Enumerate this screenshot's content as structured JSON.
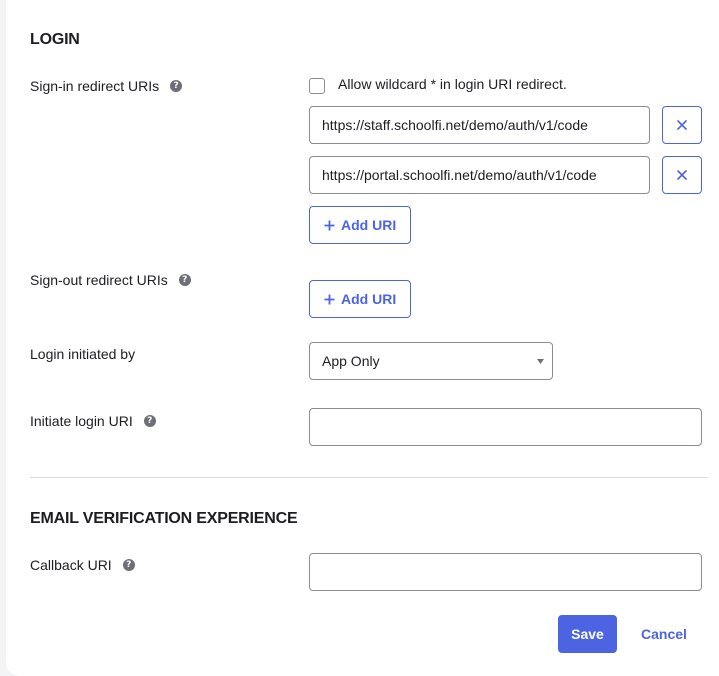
{
  "login": {
    "title": "LOGIN",
    "signin_label": "Sign-in redirect URIs",
    "wildcard_label": "Allow wildcard * in login URI redirect.",
    "signin_uris": [
      "https://staff.schoolfi.net/demo/auth/v1/code",
      "https://portal.schoolfi.net/demo/auth/v1/code"
    ],
    "add_uri_label": "Add URI",
    "signout_label": "Sign-out redirect URIs",
    "initiated_by_label": "Login initiated by",
    "initiated_by_value": "App Only",
    "initiate_uri_label": "Initiate login URI",
    "initiate_uri_value": ""
  },
  "email": {
    "title": "EMAIL VERIFICATION EXPERIENCE",
    "callback_label": "Callback URI",
    "callback_value": ""
  },
  "actions": {
    "save_label": "Save",
    "cancel_label": "Cancel"
  },
  "colors": {
    "accent": "#4c64e1"
  },
  "icons": {
    "help": "question-circle-icon",
    "remove": "close-icon",
    "add": "plus-icon",
    "dropdown": "caret-down-icon"
  }
}
